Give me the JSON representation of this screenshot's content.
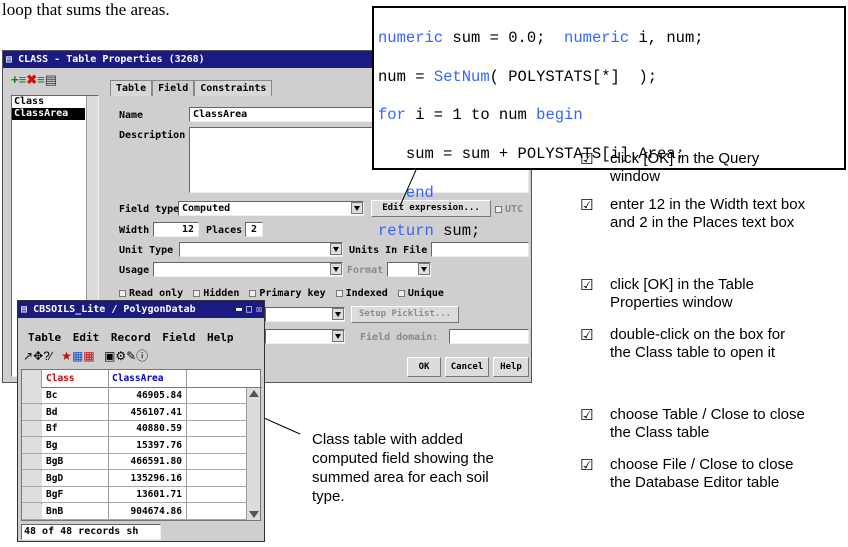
{
  "intro_text": "loop that sums the areas.",
  "code": {
    "line1": {
      "k1": "numeric",
      "t1": " sum = 0.0;  ",
      "k2": "numeric",
      "t2": " i, num;"
    },
    "line2": {
      "t1": "num = ",
      "k1": "SetNum",
      "t2": "( POLYSTATS[*]  );"
    },
    "line3": {
      "k1": "for",
      "t1": " i = 1 to num ",
      "k2": "begin"
    },
    "line4": {
      "t1": "   sum = sum + POLYSTATS[i].Area;"
    },
    "line5": {
      "k1": "   end"
    },
    "line6": {
      "k1": "return",
      "t1": " sum;"
    }
  },
  "checklist": [
    "click [OK] in the Query window",
    "enter 12 in the Width text box and 2 in the Places text box",
    "click [OK] in the Table Properties window",
    "double-click on the box for the Class table to open it",
    "choose Table / Close to close the Class table",
    "choose File / Close to close the Database Editor table"
  ],
  "caption": "Class table with added computed field showing the summed area for each soil type.",
  "props_window": {
    "title": "CLASS - Table Properties (3268)",
    "list_items": [
      "Class",
      "ClassArea"
    ],
    "tabs": [
      "Table",
      "Field",
      "Constraints"
    ],
    "name_label": "Name",
    "name_value": "ClassArea",
    "description_label": "Description",
    "field_type_label": "Field type",
    "field_type_value": "Computed",
    "edit_expression_button": "Edit expression...",
    "utc_label": "UTC",
    "width_label": "Width",
    "width_value": "12",
    "places_label": "Places",
    "places_value": "2",
    "unit_type_label": "Unit Type",
    "units_in_file_label": "Units In File",
    "usage_label": "Usage",
    "format_label": "Format",
    "read_only_label": "Read only",
    "hidden_label": "Hidden",
    "primary_key_label": "Primary key",
    "indexed_label": "Indexed",
    "unique_label": "Unique",
    "setup_picklist_button": "Setup Picklist...",
    "field_domain_label": "Field domain:",
    "ok_button": "OK",
    "cancel_button": "Cancel",
    "help_button": "Help"
  },
  "table_window": {
    "title": "CBSOILS_Lite / PolygonDatab",
    "menu": [
      "Table",
      "Edit",
      "Record",
      "Field",
      "Help"
    ],
    "columns": [
      "Class",
      "ClassArea"
    ],
    "rows": [
      [
        "Bc",
        "46905.84"
      ],
      [
        "Bd",
        "456107.41"
      ],
      [
        "Bf",
        "40880.59"
      ],
      [
        "Bg",
        "15397.76"
      ],
      [
        "BgB",
        "466591.80"
      ],
      [
        "BgD",
        "135296.16"
      ],
      [
        "BgF",
        "13601.71"
      ],
      [
        "BnB",
        "904674.86"
      ]
    ],
    "status": "48 of 48 records sh"
  },
  "colors": {
    "keyword": "#3366ff",
    "titlebar": "#1a1a80",
    "class_header": "#cc0000",
    "classarea_header": "#0000cc"
  }
}
